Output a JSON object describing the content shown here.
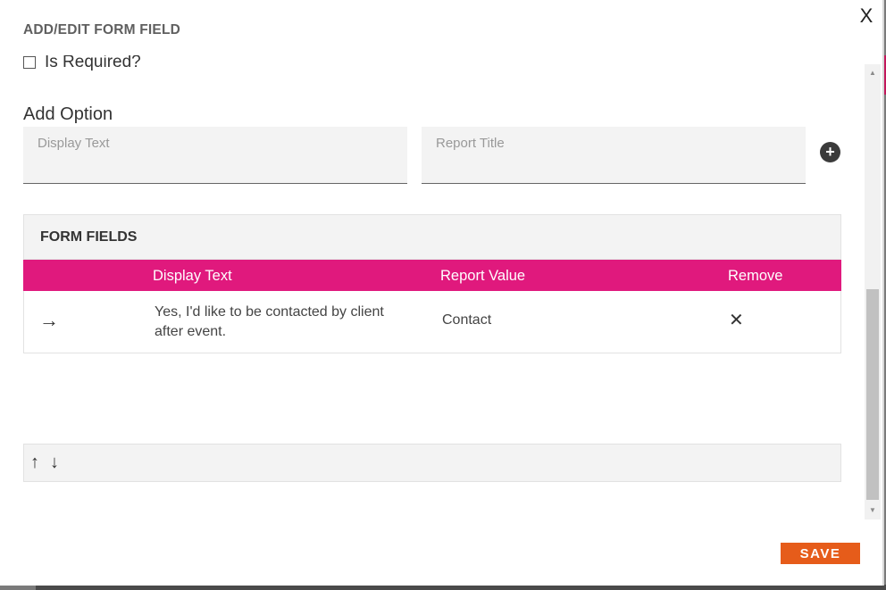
{
  "modal": {
    "title": "ADD/EDIT FORM FIELD",
    "close_label": "X"
  },
  "required": {
    "label": "Is Required?",
    "checked": false
  },
  "add_option": {
    "heading": "Add Option",
    "display_text_placeholder": "Display Text",
    "report_title_placeholder": "Report Title",
    "add_icon": "plus-circle-icon",
    "add_glyph": "+"
  },
  "form_fields": {
    "title": "FORM FIELDS",
    "columns": [
      "Display Text",
      "Report Value",
      "Remove"
    ],
    "rows": [
      {
        "display_text": "Yes, I'd like to be contacted by client after event.",
        "report_value": "Contact",
        "drag_icon": "arrow-right-icon",
        "drag_glyph": "→",
        "remove_icon": "close-icon",
        "remove_glyph": "✕"
      }
    ]
  },
  "sort": {
    "up_icon": "arrow-up-icon",
    "up_glyph": "↑",
    "down_icon": "arrow-down-icon",
    "down_glyph": "↓"
  },
  "scrollbar": {
    "up_glyph": "▲",
    "down_glyph": "▼"
  },
  "footer": {
    "save_label": "SAVE"
  },
  "colors": {
    "table_header": "#e0197d",
    "save_button": "#e65c1a",
    "field_background": "#f3f3f3"
  }
}
